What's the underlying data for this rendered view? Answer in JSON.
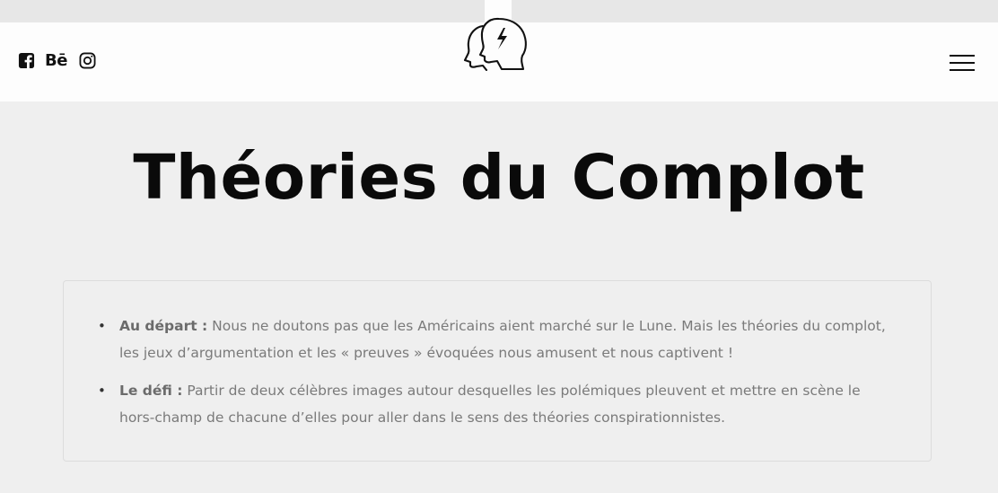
{
  "header": {
    "social": {
      "facebook_icon": "facebook-square-icon",
      "behance_label": "Bē",
      "instagram_icon": "instagram-icon"
    },
    "logo_icon": "two-heads-lightning-logo",
    "menu_icon": "hamburger-menu-icon"
  },
  "main": {
    "title": "Théories du Complot",
    "items": [
      {
        "label": "Au départ :",
        "text": " Nous ne doutons pas que les Américains aient marché sur le Lune. Mais les théories du complot, les jeux d’argumentation et les « preuves » évoquées nous amusent et nous captivent !"
      },
      {
        "label": "Le défi :",
        "text": " Partir de deux célèbres images autour desquelles les polémiques pleuvent et mettre en scène le hors-champ de chacune d’elles pour aller dans le sens des théories conspirationnistes."
      }
    ]
  }
}
